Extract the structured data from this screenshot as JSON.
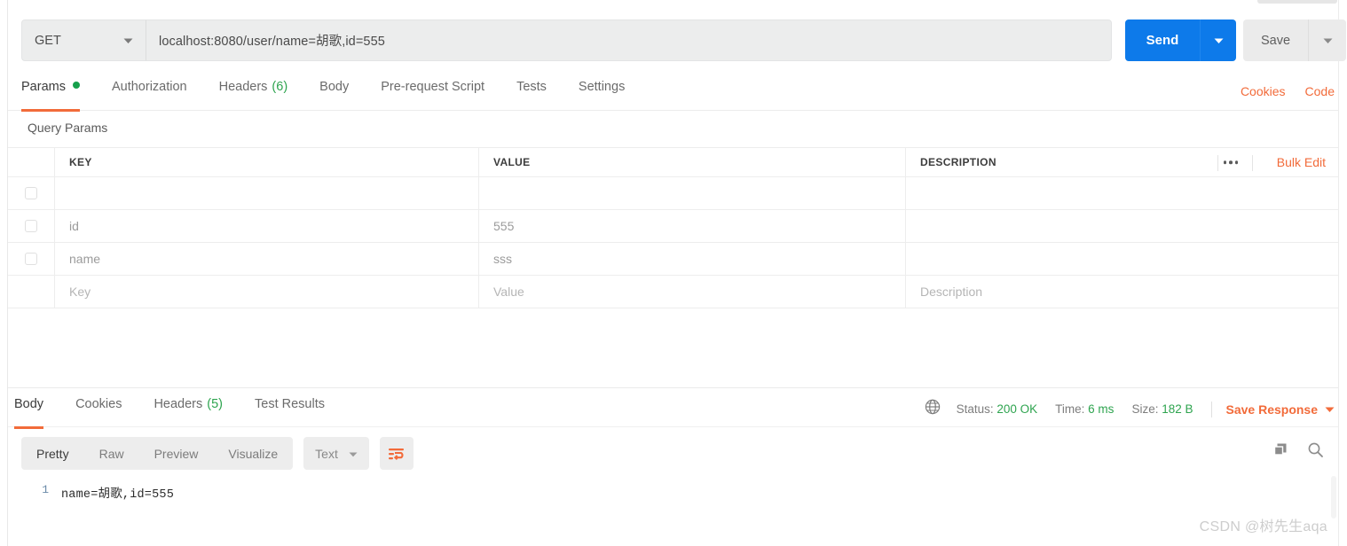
{
  "request": {
    "method": "GET",
    "method_caret_icon": "chevron-down-icon",
    "url": "localhost:8080/user/name=胡歌,id=555",
    "url_placeholder": "Enter request URL",
    "send_label": "Send",
    "send_caret_icon": "chevron-down-icon",
    "save_label": "Save",
    "save_caret_icon": "chevron-down-icon"
  },
  "request_tabs": [
    {
      "label": "Params",
      "badge": "",
      "indicator": "dot",
      "active": true
    },
    {
      "label": "Authorization",
      "badge": "",
      "indicator": "",
      "active": false
    },
    {
      "label": "Headers",
      "badge": "(6)",
      "indicator": "",
      "active": false
    },
    {
      "label": "Body",
      "badge": "",
      "indicator": "",
      "active": false
    },
    {
      "label": "Pre-request Script",
      "badge": "",
      "indicator": "",
      "active": false
    },
    {
      "label": "Tests",
      "badge": "",
      "indicator": "",
      "active": false
    },
    {
      "label": "Settings",
      "badge": "",
      "indicator": "",
      "active": false
    }
  ],
  "header_links": [
    {
      "label": "Cookies"
    },
    {
      "label": "Code"
    }
  ],
  "query_params": {
    "title": "Query Params",
    "columns": [
      "KEY",
      "VALUE",
      "DESCRIPTION"
    ],
    "more_icon": "ellipsis-icon",
    "bulk_edit_label": "Bulk Edit",
    "rows": [
      {
        "checkbox": true,
        "key": "",
        "value": "",
        "description": "",
        "placeholder_row": false
      },
      {
        "checkbox": true,
        "key": "id",
        "value": "555",
        "description": "",
        "placeholder_row": false
      },
      {
        "checkbox": true,
        "key": "name",
        "value": "sss",
        "description": "",
        "placeholder_row": false
      },
      {
        "checkbox": false,
        "key": "Key",
        "value": "Value",
        "description": "Description",
        "placeholder_row": true
      }
    ]
  },
  "response_tabs": [
    {
      "label": "Body",
      "badge": "",
      "active": true
    },
    {
      "label": "Cookies",
      "badge": "",
      "active": false
    },
    {
      "label": "Headers",
      "badge": "(5)",
      "active": false
    },
    {
      "label": "Test Results",
      "badge": "",
      "active": false
    }
  ],
  "response_status": {
    "globe_icon": "globe-icon",
    "status_label": "Status:",
    "status_value": "200 OK",
    "time_label": "Time:",
    "time_value": "6 ms",
    "size_label": "Size:",
    "size_value": "182 B",
    "save_response_label": "Save Response",
    "save_response_caret_icon": "chevron-down-icon"
  },
  "body_toolbar": {
    "views": [
      {
        "label": "Pretty",
        "active": true
      },
      {
        "label": "Raw",
        "active": false
      },
      {
        "label": "Preview",
        "active": false
      },
      {
        "label": "Visualize",
        "active": false
      }
    ],
    "type_label": "Text",
    "type_caret_icon": "chevron-down-icon",
    "wrap_icon": "word-wrap-icon",
    "copy_icon": "copy-icon",
    "search_icon": "search-icon"
  },
  "response_body": {
    "lines": [
      {
        "number": "1",
        "text": "name=胡歌,id=555"
      }
    ]
  },
  "watermark": {
    "text": "CSDN @树先生aqa"
  },
  "colors": {
    "accent_orange": "#f26b3a",
    "send_blue": "#0d7aea",
    "status_green": "#2ea44f",
    "dot_green": "#16a04c",
    "panel_grey": "#eceded"
  }
}
